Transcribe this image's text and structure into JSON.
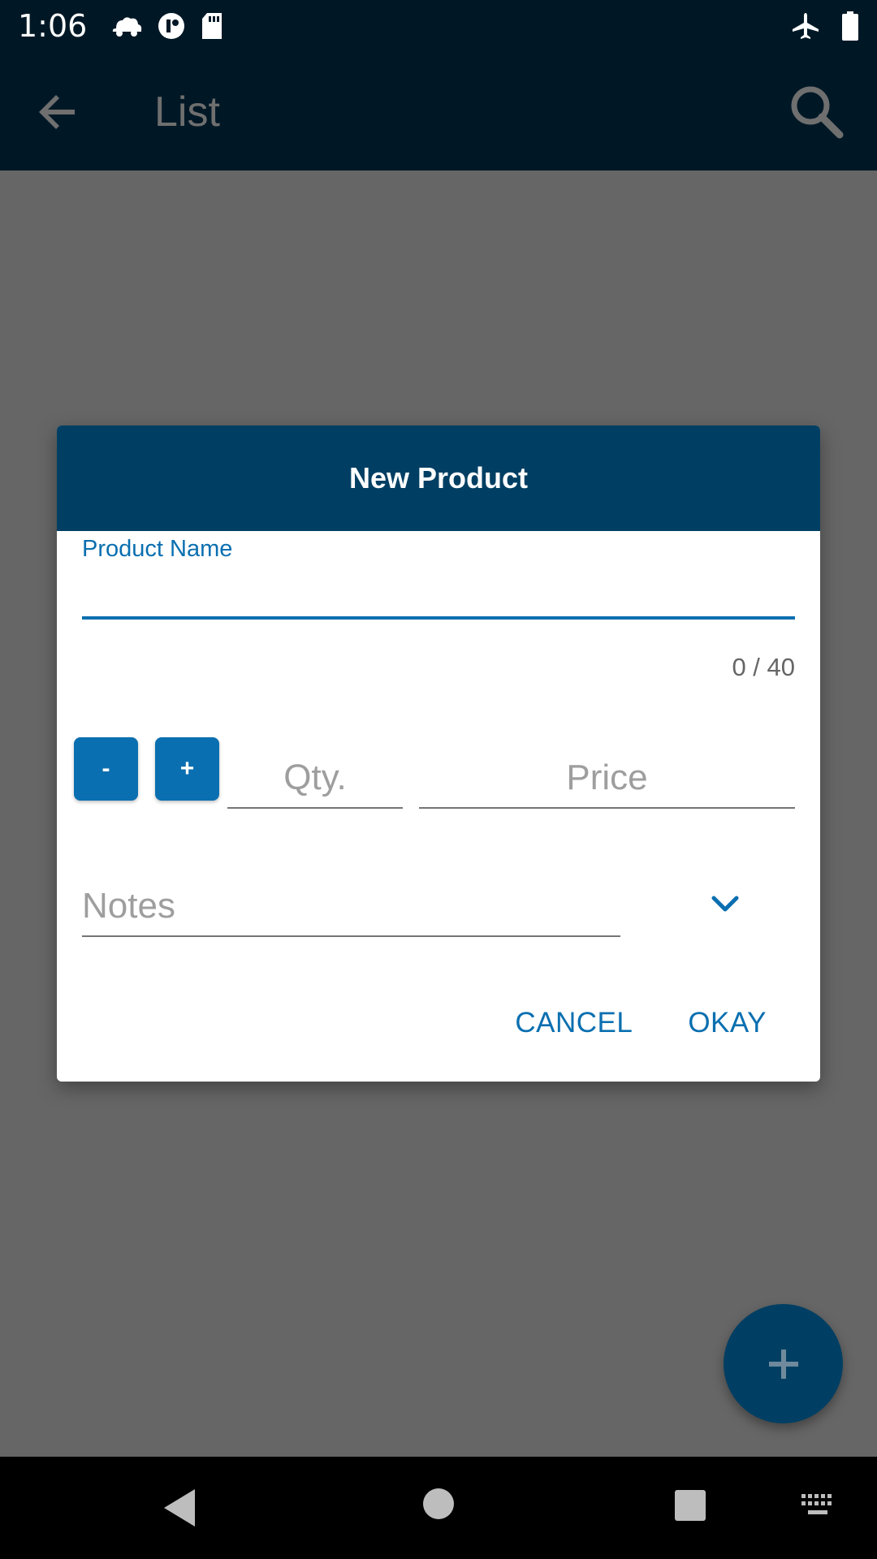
{
  "status_bar": {
    "time": "1:06",
    "icons": [
      "cloud-car-icon",
      "usage-icon",
      "sd-card-icon",
      "airplane-mode-icon",
      "battery-icon"
    ]
  },
  "app_bar": {
    "title": "List",
    "back_icon": "arrow-left-icon",
    "search_icon": "search-icon"
  },
  "dialog": {
    "title": "New Product",
    "product_name": {
      "label": "Product Name",
      "value": "",
      "counter": "0 / 40"
    },
    "stepper": {
      "minus_label": "-",
      "plus_label": "+"
    },
    "qty": {
      "placeholder": "Qty.",
      "value": ""
    },
    "price": {
      "placeholder": "Price",
      "value": ""
    },
    "notes": {
      "placeholder": "Notes",
      "value": ""
    },
    "actions": {
      "cancel_label": "CANCEL",
      "okay_label": "OKAY"
    }
  },
  "fab": {
    "icon": "plus-icon"
  },
  "colors": {
    "primary": "#0a6fb0",
    "header": "#003f63",
    "app_bar": "#001826",
    "scrim": "#666666"
  }
}
